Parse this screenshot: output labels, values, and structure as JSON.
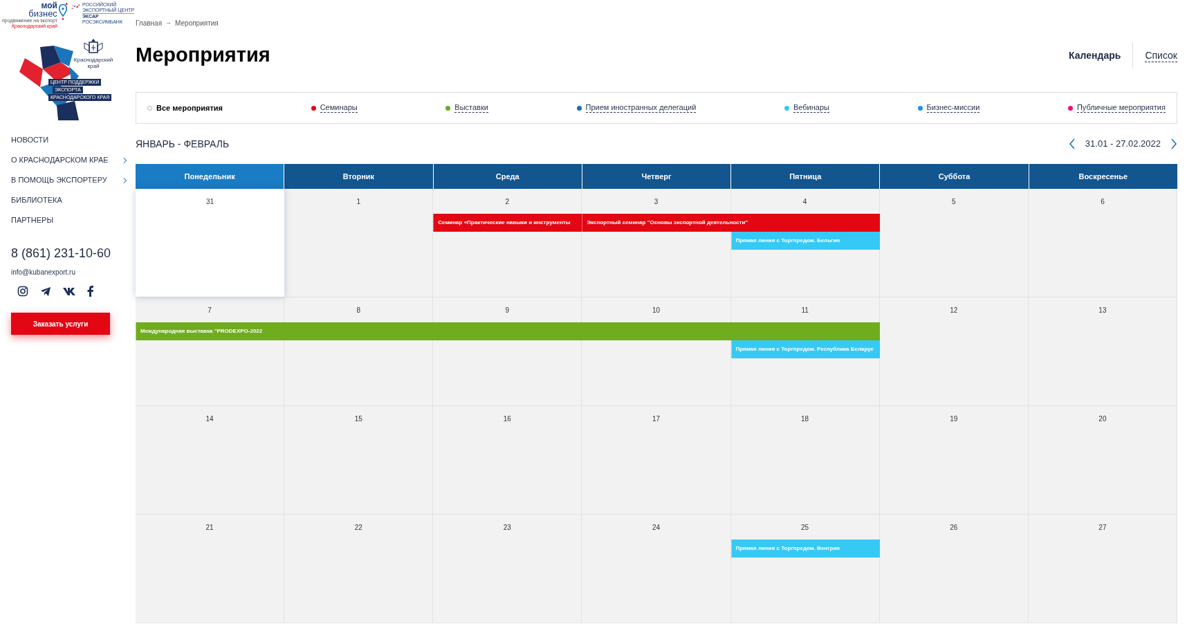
{
  "logos": {
    "moy_biznes": [
      "мой",
      "бизнес",
      "продвижение на экспорт",
      "Краснодарский край"
    ],
    "rec": [
      "РОССИЙСКИЙ",
      "ЭКСПОРТНЫЙ ЦЕНТР",
      "ЭКСАР",
      "РОСЭКСИМБАНК"
    ],
    "region": "Краснодарский край",
    "center": [
      "ЦЕНТР ПОДДЕРЖКИ",
      "ЭКСПОРТА",
      "КРАСНОДАРСКОГО КРАЯ"
    ]
  },
  "sidebar": {
    "items": [
      {
        "label": "НОВОСТИ",
        "has_submenu": false
      },
      {
        "label": "О КРАСНОДАРСКОМ КРАЕ",
        "has_submenu": true
      },
      {
        "label": "В ПОМОЩЬ ЭКСПОРТЕРУ",
        "has_submenu": true
      },
      {
        "label": "БИБЛИОТЕКА",
        "has_submenu": false
      },
      {
        "label": "ПАРТНЕРЫ",
        "has_submenu": false
      }
    ],
    "phone": "8 (861) 231-10-60",
    "email": "info@kubanexport.ru",
    "socials": [
      {
        "kind": "instagram"
      },
      {
        "kind": "telegram"
      },
      {
        "kind": "vk"
      },
      {
        "kind": "facebook"
      }
    ],
    "order_button": "Заказать услуги"
  },
  "breadcrumbs": [
    "Главная",
    "Мероприятия"
  ],
  "breadcrumb_separator": "→",
  "title": "Мероприятия",
  "views": [
    {
      "label": "Календарь",
      "selected": true
    },
    {
      "label": "Список",
      "selected": false
    }
  ],
  "filters": [
    {
      "label": "Все мероприятия",
      "selected": true
    },
    {
      "label": "Семинары",
      "selected": false,
      "color": "#e30613"
    },
    {
      "label": "Выставки",
      "selected": false,
      "color": "#6fac1e"
    },
    {
      "label": "Прием иностранных делегаций",
      "selected": false,
      "color": "#1470b8"
    },
    {
      "label": "Вебинары",
      "selected": false,
      "color": "#36c9f5"
    },
    {
      "label": "Бизнес-миссии",
      "selected": false,
      "color": "#2a8ee0"
    },
    {
      "label": "Публичные мероприятия",
      "selected": false,
      "color": "#f0127a"
    }
  ],
  "period_label": "ЯНВАРЬ - ФЕВРАЛЬ",
  "date_range": "31.01 - 27.02.2022",
  "weekdays": [
    {
      "label": "Понедельник",
      "current": true
    },
    {
      "label": "Вторник",
      "current": false
    },
    {
      "label": "Среда",
      "current": false
    },
    {
      "label": "Четверг",
      "current": false
    },
    {
      "label": "Пятница",
      "current": false
    },
    {
      "label": "Суббота",
      "current": false
    },
    {
      "label": "Воскресенье",
      "current": false
    }
  ],
  "weeks": [
    {
      "days": [
        {
          "date": "31",
          "today": true
        },
        {
          "date": "1",
          "today": false
        },
        {
          "date": "2",
          "today": false,
          "events": [
            {
              "title": "Семинар «Практические навыки и инструменты",
              "color": "#e30613",
              "continued": false
            }
          ]
        },
        {
          "date": "3",
          "today": false,
          "events": [
            {
              "title": "Экспортный семинар \"Основы экспортной деятельности\"",
              "color": "#e30613",
              "continued": false
            }
          ]
        },
        {
          "date": "4",
          "today": false,
          "events": [
            {
              "continued": true
            },
            {
              "title": "Прямая линия с Торгпредом. Бельгия",
              "color": "#36c9f5",
              "continued": false
            }
          ]
        },
        {
          "date": "5",
          "today": false
        },
        {
          "date": "6",
          "today": false
        }
      ]
    },
    {
      "days": [
        {
          "date": "7",
          "today": false,
          "events": [
            {
              "title": "Международная выставка \"PRODEXPO-2022",
              "color": "#6fac1e",
              "continued": false
            }
          ]
        },
        {
          "date": "8",
          "today": false,
          "events": [
            {
              "continued": true
            }
          ]
        },
        {
          "date": "9",
          "today": false,
          "events": [
            {
              "continued": true
            }
          ]
        },
        {
          "date": "10",
          "today": false,
          "events": [
            {
              "continued": true
            }
          ]
        },
        {
          "date": "11",
          "today": false,
          "events": [
            {
              "continued": true
            },
            {
              "title": "Прямая линия с Торгпредом. Республика Беларус",
              "color": "#36c9f5",
              "continued": false
            }
          ]
        },
        {
          "date": "12",
          "today": false
        },
        {
          "date": "13",
          "today": false
        }
      ]
    },
    {
      "days": [
        {
          "date": "14",
          "today": false
        },
        {
          "date": "15",
          "today": false
        },
        {
          "date": "16",
          "today": false
        },
        {
          "date": "17",
          "today": false
        },
        {
          "date": "18",
          "today": false
        },
        {
          "date": "19",
          "today": false
        },
        {
          "date": "20",
          "today": false
        }
      ]
    },
    {
      "days": [
        {
          "date": "21",
          "today": false
        },
        {
          "date": "22",
          "today": false
        },
        {
          "date": "23",
          "today": false
        },
        {
          "date": "24",
          "today": false
        },
        {
          "date": "25",
          "today": false,
          "events": [
            {
              "title": "Прямая линия с Торгпредом. Венгрия",
              "color": "#36c9f5",
              "continued": false
            }
          ]
        },
        {
          "date": "26",
          "today": false
        },
        {
          "date": "27",
          "today": false
        }
      ]
    }
  ]
}
